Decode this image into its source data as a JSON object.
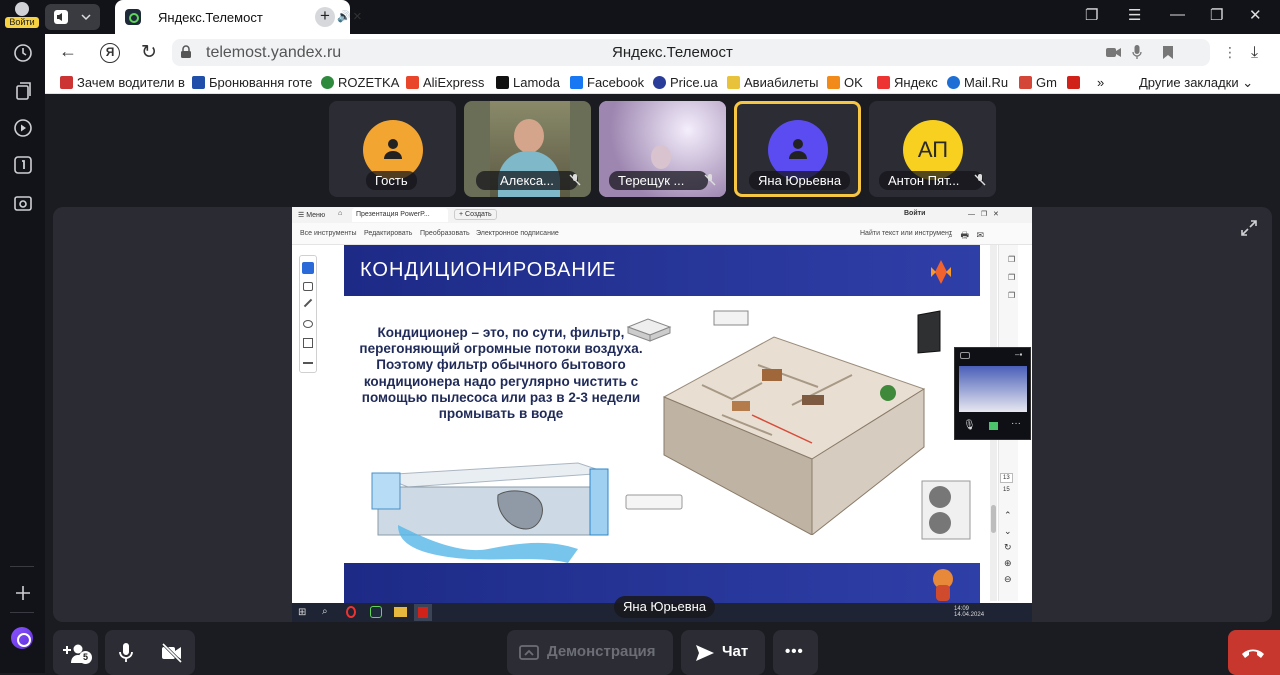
{
  "sidebar": {
    "login_label": "Войти"
  },
  "browser": {
    "tab_title": "Яндекс.Телемост",
    "yandex_letter": "Я",
    "url": "telemost.yandex.ru",
    "page_title": "Яндекс.Телемост",
    "bookmarks": [
      "Зачем водители в",
      "Бронювання готе",
      "ROZETKA",
      "AliExpress",
      "Lamoda",
      "Facebook",
      "Price.ua",
      "Авиабилеты",
      "OK",
      "Яндекс",
      "Mail.Ru",
      "Gm"
    ],
    "bookmarks_more": "»",
    "other_bookmarks": "Другие закладки"
  },
  "participants": [
    {
      "name": "Гость",
      "initials": "",
      "avatar_color": "#f3a531",
      "muted": false,
      "active": false,
      "video": false
    },
    {
      "name": "Алекса...",
      "initials": "",
      "avatar_color": "#6b6e57",
      "muted": true,
      "active": false,
      "video": true
    },
    {
      "name": "Терещук ...",
      "initials": "",
      "avatar_color": "#b79fc9",
      "muted": true,
      "active": false,
      "video": true
    },
    {
      "name": "Яна Юрьевна",
      "initials": "",
      "avatar_color": "#5a4cf0",
      "muted": false,
      "active": true,
      "video": false
    },
    {
      "name": "Антон Пят...",
      "initials": "АП",
      "avatar_color": "#f7d020",
      "muted": true,
      "active": false,
      "video": false
    }
  ],
  "screen_share": {
    "tab_label": "Презентация PowerP...",
    "new_tab": "Создать",
    "menu_label": "Меню",
    "login": "Войти",
    "toolbar": [
      "Все инструменты",
      "Редактировать",
      "Преобразовать",
      "Электронное подписание"
    ],
    "search": "Найти текст или инструмент",
    "slide_title": "КОНДИЦИОНИРОВАНИЕ",
    "slide_text": "Кондиционер – это, по сути, фильтр, перегоняющий огромные потоки воздуха. Поэтому фильтр обычного бытового кондиционера надо регулярно чистить с помощью пылесоса или раз в 2-3 недели промывать в воде",
    "page_num": "13",
    "page_total": "15",
    "taskbar_time": "14:09",
    "taskbar_date": "14.04.2024"
  },
  "speaker_label": "Яна Юрьевна",
  "controls": {
    "participants_count": "5",
    "demo_label": "Демонстрация",
    "chat_label": "Чат",
    "more_label": "•••"
  },
  "colors": {
    "accent_yellow": "#f7c743",
    "hangup_red": "#c8372d",
    "slide_blue": "#23318f"
  }
}
